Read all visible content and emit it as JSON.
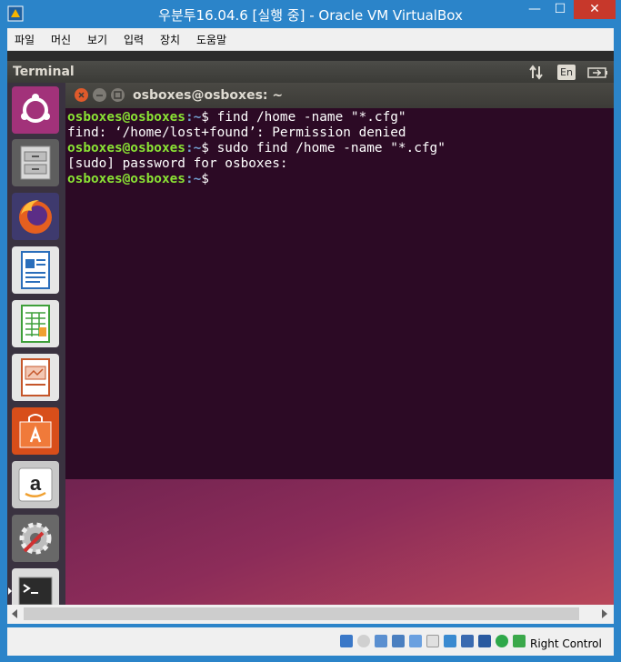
{
  "window": {
    "title": "우분투16.04.6 [실행 중] - Oracle VM VirtualBox",
    "min_glyph": "—",
    "max_glyph": "☐",
    "close_glyph": "✕"
  },
  "menu": [
    "파일",
    "머신",
    "보기",
    "입력",
    "장치",
    "도움말"
  ],
  "ubuntu_panel": {
    "title": "Terminal",
    "keyboard_indicator": "En"
  },
  "launcher": [
    {
      "name": "ubuntu-dash",
      "color": "#a2327a"
    },
    {
      "name": "files",
      "color": "#6a6a6a"
    },
    {
      "name": "firefox",
      "color": "#e55f1f"
    },
    {
      "name": "libreoffice-writer",
      "color": "#2a6ebb"
    },
    {
      "name": "libreoffice-calc",
      "color": "#3e9f3a"
    },
    {
      "name": "libreoffice-impress",
      "color": "#c5562a"
    },
    {
      "name": "ubuntu-software",
      "color": "#e95420"
    },
    {
      "name": "amazon",
      "color": "#f0f0f0"
    },
    {
      "name": "system-settings",
      "color": "#777777"
    },
    {
      "name": "terminal",
      "color": "#2b2b2b"
    }
  ],
  "terminal": {
    "title": "osboxes@osboxes: ~",
    "lines": [
      {
        "user": "osboxes@osboxes",
        "path": ":~",
        "rest": "$ find /home -name \"*.cfg\""
      },
      {
        "text": "find: ‘/home/lost+found’: Permission denied"
      },
      {
        "user": "osboxes@osboxes",
        "path": ":~",
        "rest": "$ sudo find /home -name \"*.cfg\""
      },
      {
        "text": "[sudo] password for osboxes:"
      },
      {
        "user": "osboxes@osboxes",
        "path": ":~",
        "rest": "$"
      }
    ]
  },
  "status": {
    "host_key": "Right Control"
  },
  "colors": {
    "host_blue": "#2b84c9",
    "terminal_bg": "#2c0a25",
    "prompt_user": "#8ae234",
    "prompt_path": "#729fcf"
  }
}
